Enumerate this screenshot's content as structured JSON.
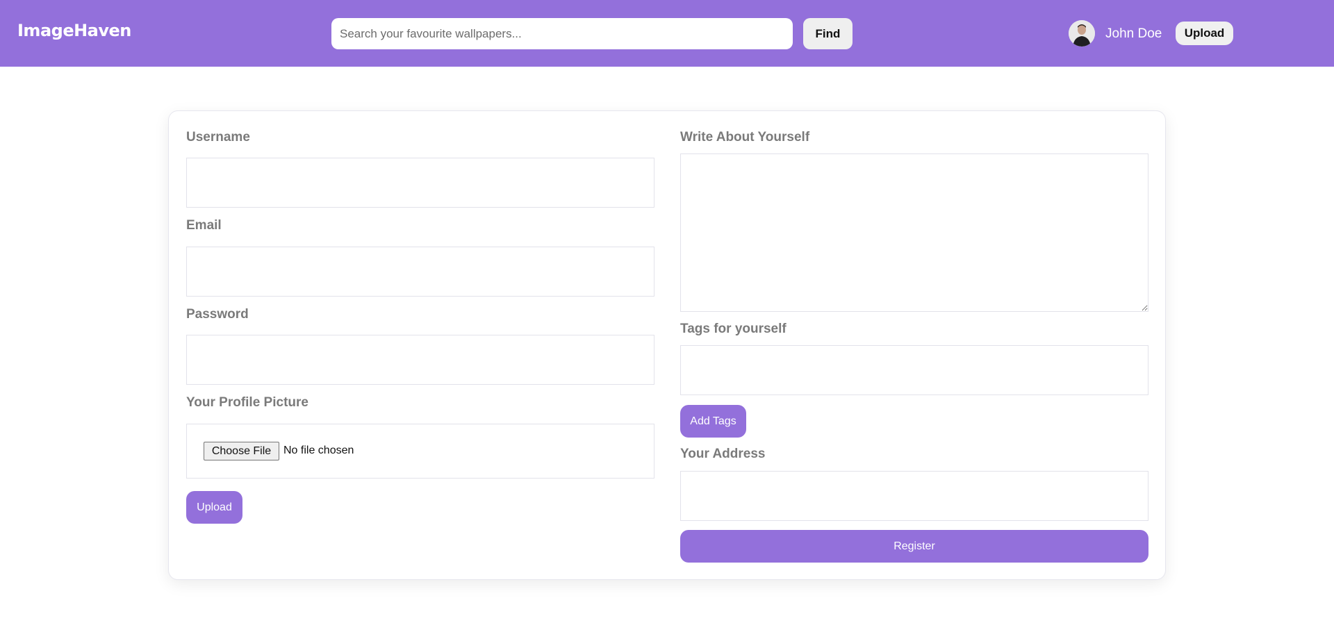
{
  "header": {
    "brand": "ImageHaven",
    "search_placeholder": "Search your favourite wallpapers...",
    "find_label": "Find",
    "user_name": "John Doe",
    "upload_label": "Upload"
  },
  "form": {
    "username_label": "Username",
    "email_label": "Email",
    "password_label": "Password",
    "profile_picture_label": "Your Profile Picture",
    "choose_file_label": "Choose File",
    "no_file_text": "No file chosen",
    "upload_label": "Upload",
    "about_label": "Write About Yourself",
    "tags_label": "Tags for yourself",
    "add_tags_label": "Add Tags",
    "address_label": "Your Address",
    "register_label": "Register"
  },
  "colors": {
    "accent": "#9370db",
    "label": "#7a7a7a",
    "background": "#ffffff"
  }
}
